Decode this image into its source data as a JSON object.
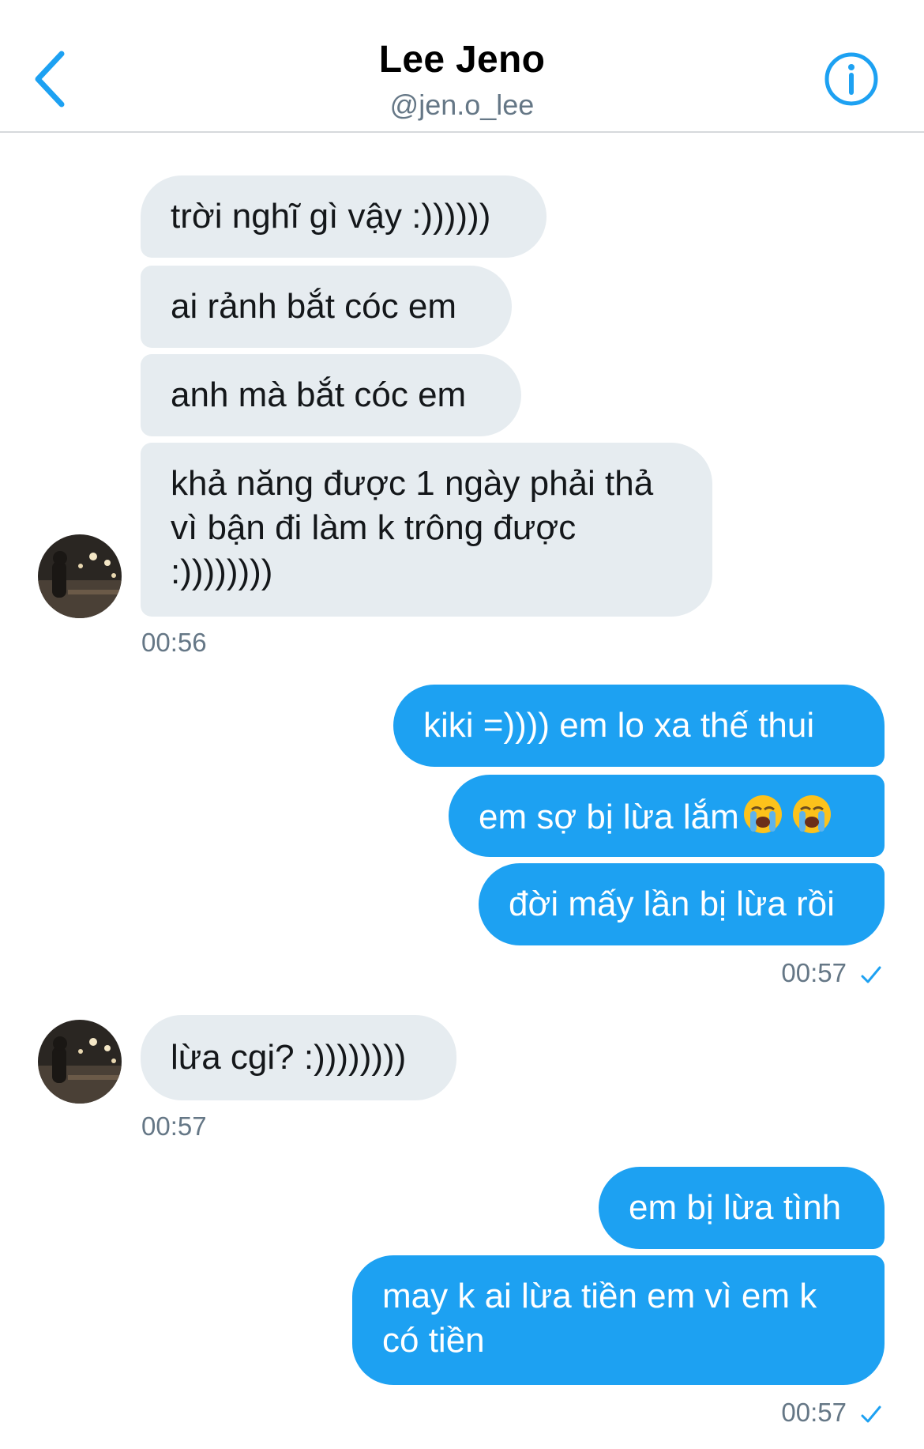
{
  "header": {
    "title": "Lee Jeno",
    "handle": "@jen.o_lee",
    "back_icon": "chevron-left-icon",
    "info_icon": "info-icon",
    "accent_color": "#1da1f2"
  },
  "conversation": {
    "group1_incoming": [
      "trời nghĩ gì vậy :))))))",
      "ai rảnh bắt cóc em",
      "anh mà bắt cóc em",
      "khả năng được 1 ngày phải thả vì bận đi làm k trông được :))))))))"
    ],
    "group1_time": "00:56",
    "group2_outgoing": [
      "kiki =)))) em lo xa thế thui",
      "em sợ bị lừa lắm",
      "đời mấy lần bị lừa rồi"
    ],
    "group2_emoji": "loudly-crying-face-icon",
    "group2_time": "00:57",
    "group3_incoming": [
      "lừa cgi? :))))))))"
    ],
    "group3_time": "00:57",
    "group4_outgoing": [
      "em bị lừa tình",
      "may k ai lừa tiền em vì em k có tiền"
    ],
    "group4_time": "00:57"
  },
  "colors": {
    "incoming_bubble": "#e6ecf0",
    "outgoing_bubble": "#1da1f2",
    "timestamp": "#657786"
  }
}
